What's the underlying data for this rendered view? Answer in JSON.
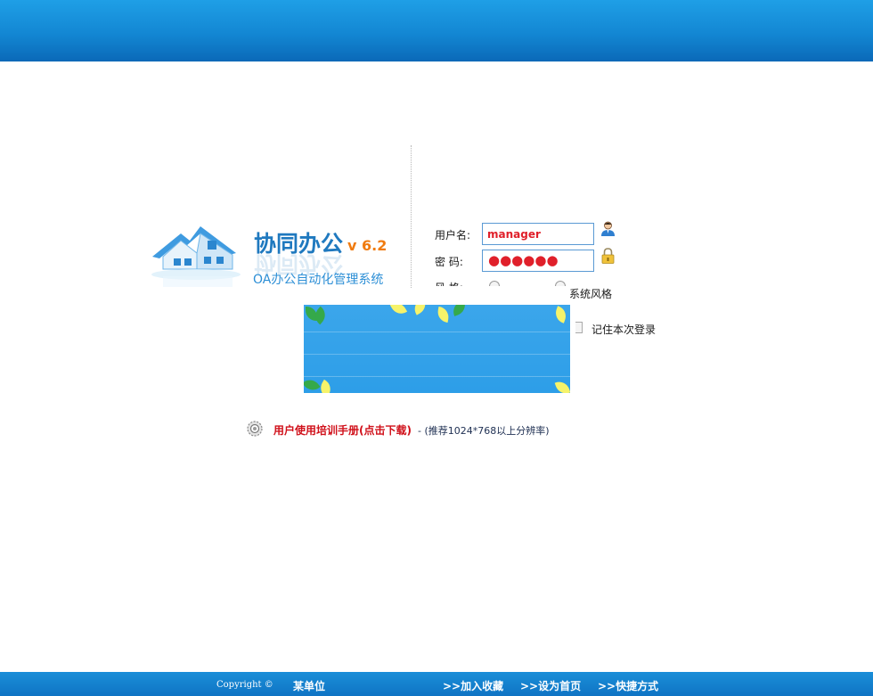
{
  "logo": {
    "title": "协同办公",
    "version": "v 6.2",
    "subtitle": "OA办公自动化管理系统"
  },
  "login": {
    "username_label": "用户名:",
    "username_value": "manager",
    "password_label": "密  码:",
    "password_dots": "●●●●●●",
    "style_label": "风  格:",
    "style_option_2": "系统风格",
    "remember_label": "记住本次登录"
  },
  "manual": {
    "link_text": "用户使用培训手册(点击下载)",
    "note": "- (推荐1024*768以上分辨率)"
  },
  "footer": {
    "copyright": "Copyright ©",
    "org": "某单位",
    "links": [
      ">>加入收藏",
      ">>设为首页",
      ">>快捷方式"
    ]
  },
  "colors": {
    "header_blue": "#1387d3",
    "accent_red": "#e0202a",
    "logo_blue": "#1f79bf",
    "version_orange": "#f07b10"
  }
}
